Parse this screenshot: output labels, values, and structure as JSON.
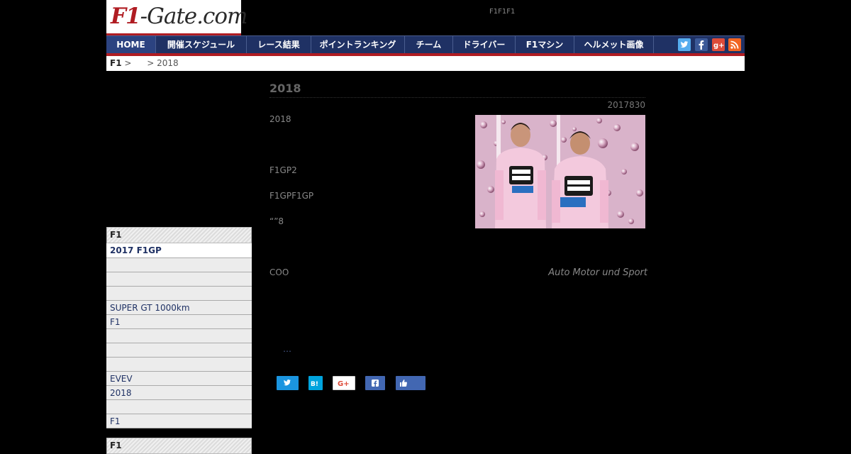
{
  "header": {
    "logo_main": "F1",
    "logo_rest": "-Gate.com",
    "tagline": "F1F1F1"
  },
  "nav": {
    "items": [
      {
        "label": "HOME"
      },
      {
        "label": "開催スケジュール"
      },
      {
        "label": "レース結果"
      },
      {
        "label": "ポイントランキング"
      },
      {
        "label": "チーム"
      },
      {
        "label": "ドライバー"
      },
      {
        "label": "F1マシン"
      },
      {
        "label": "ヘルメット画像"
      }
    ],
    "social": [
      {
        "icon": "twitter-icon",
        "color": "#55acee"
      },
      {
        "icon": "facebook-icon",
        "color": "#3b5998"
      },
      {
        "icon": "google-plus-icon",
        "color": "#dd4b39"
      },
      {
        "icon": "rss-icon",
        "color": "#f26522"
      }
    ]
  },
  "breadcrumb": {
    "home": "F1",
    "sep1": ">",
    "current": "> 2018"
  },
  "sidebar": {
    "section1_title": "F1",
    "items": [
      "2017 F1GP",
      "",
      "",
      "",
      "SUPER GT 1000km",
      "F1",
      "",
      "",
      "",
      "EVEV",
      "2018",
      "",
      "F1"
    ],
    "section2_title": "F1"
  },
  "article": {
    "title": "2018",
    "date": "2017830",
    "para1": "2018",
    "para2": "F1GP2",
    "para3": "F1GPF1GP",
    "para4": "“”8",
    "para5": "COO",
    "source": "Auto Motor und Sport",
    "more": "…",
    "photo_icon": "driver-photo-image"
  },
  "share": {
    "twitter_icon": "twitter-share-icon",
    "hatena_icon": "hatena-bookmark-icon",
    "hatena_label": "B!",
    "google_icon": "google-plus-share-icon",
    "google_label": "G+",
    "facebook_icon": "facebook-share-icon",
    "like_icon": "like-icon"
  }
}
